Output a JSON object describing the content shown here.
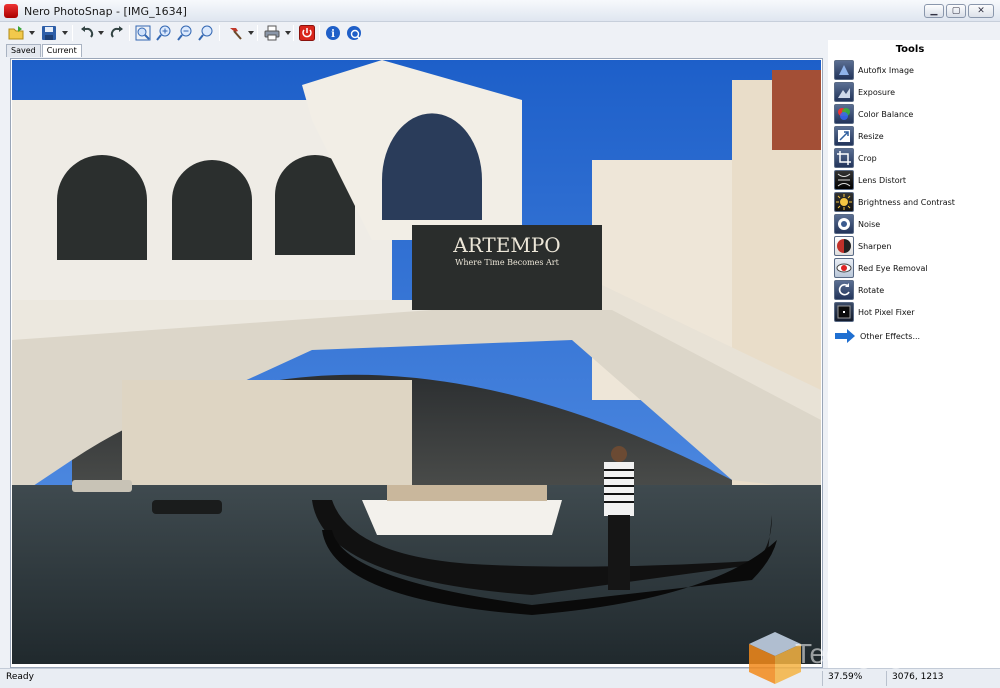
{
  "window": {
    "title": "Nero PhotoSnap - [IMG_1634]"
  },
  "toolbar": {
    "buttons": [
      {
        "name": "open",
        "glyph": "📂"
      },
      {
        "name": "save",
        "glyph": "💾"
      },
      {
        "name": "undo",
        "glyph": "↶"
      },
      {
        "name": "redo",
        "glyph": "↷"
      },
      {
        "name": "zoom-fit",
        "glyph": "⊡"
      },
      {
        "name": "zoom-in",
        "glyph": "🔍"
      },
      {
        "name": "zoom-out",
        "glyph": "🔍"
      },
      {
        "name": "zoom-actual",
        "glyph": "🔍"
      },
      {
        "name": "tools",
        "glyph": "🔨"
      },
      {
        "name": "print",
        "glyph": "🖨"
      },
      {
        "name": "exit",
        "glyph": "⏻"
      },
      {
        "name": "info",
        "glyph": "ℹ"
      },
      {
        "name": "help",
        "glyph": "?"
      }
    ]
  },
  "tabs": [
    {
      "label": "Saved"
    },
    {
      "label": "Current"
    }
  ],
  "image": {
    "banner_title": "ARTEMPO",
    "banner_subtitle": "Where Time Becomes Art"
  },
  "tools_panel": {
    "title": "Tools",
    "items": [
      {
        "label": "Autofix Image",
        "icon": "autofix-icon",
        "color": "#3f6db5"
      },
      {
        "label": "Exposure",
        "icon": "exposure-icon",
        "color": "#6a7fa5"
      },
      {
        "label": "Color Balance",
        "icon": "color-balance-icon",
        "color": "#d23a2a"
      },
      {
        "label": "Resize",
        "icon": "resize-icon",
        "color": "#2f5f9e"
      },
      {
        "label": "Crop",
        "icon": "crop-icon",
        "color": "#2d4d80"
      },
      {
        "label": "Lens Distort",
        "icon": "lens-distort-icon",
        "color": "#1a1a1a"
      },
      {
        "label": "Brightness and Contrast",
        "icon": "brightness-contrast-icon",
        "color": "#c8a52a"
      },
      {
        "label": "Noise",
        "icon": "noise-icon",
        "color": "#445a84"
      },
      {
        "label": "Sharpen",
        "icon": "sharpen-icon",
        "color": "#c0312a"
      },
      {
        "label": "Red Eye Removal",
        "icon": "red-eye-icon",
        "color": "#b2312b"
      },
      {
        "label": "Rotate",
        "icon": "rotate-icon",
        "color": "#3e5d8f"
      },
      {
        "label": "Hot Pixel Fixer",
        "icon": "hot-pixel-icon",
        "color": "#2a3b5a"
      },
      {
        "label": "Other Effects...",
        "icon": "arrow-right-icon",
        "color": "#1f6fd1"
      }
    ]
  },
  "status": {
    "text": "Ready",
    "zoom": "37.59%",
    "coords": "3076, 1213"
  },
  "watermark": {
    "text": "Techgage.com"
  }
}
